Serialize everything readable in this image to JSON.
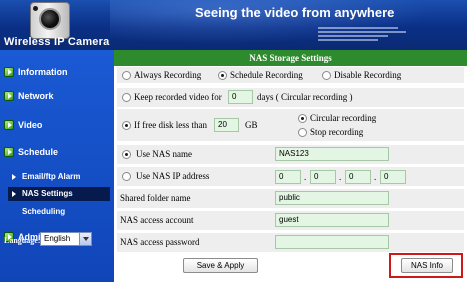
{
  "header": {
    "brand_title": "Wireless IP Camera",
    "tagline": "Seeing the video from anywhere"
  },
  "sidebar": {
    "items": [
      {
        "label": "Information"
      },
      {
        "label": "Network"
      },
      {
        "label": "Video"
      },
      {
        "label": "Schedule"
      },
      {
        "label": "Admin"
      }
    ],
    "schedule_sub": [
      {
        "label": "Email/ftp Alarm"
      },
      {
        "label": "NAS Settings",
        "active": true
      },
      {
        "label": "Scheduling"
      }
    ],
    "language_label": "Language:",
    "language_value": "English"
  },
  "panel": {
    "title": "NAS Storage Settings",
    "recording_modes": {
      "always": "Always Recording",
      "schedule": "Schedule Recording",
      "disable": "Disable Recording",
      "selected": "schedule"
    },
    "keep_video": {
      "prefix": "Keep recorded video for",
      "days_value": "0",
      "suffix": "days ( Circular recording )"
    },
    "free_disk": {
      "prefix": "If free disk less than",
      "gb_value": "20",
      "unit": "GB",
      "option_circular": "Circular recording",
      "option_stop": "Stop recording",
      "selected": "circular"
    },
    "use_nas_name": {
      "label": "Use NAS name",
      "value": "NAS123",
      "selected": true
    },
    "use_nas_ip": {
      "label": "Use NAS IP address",
      "octets": [
        "0",
        "0",
        "0",
        "0"
      ],
      "separator": "."
    },
    "shared_folder": {
      "label": "Shared folder name",
      "value": "public"
    },
    "access_account": {
      "label": "NAS access account",
      "value": "guest"
    },
    "access_password": {
      "label": "NAS access password",
      "value": ""
    },
    "save_button": "Save & Apply",
    "nas_info_button": "NAS Info"
  },
  "colors": {
    "header_blue": "#0a2f86",
    "sidebar_blue": "#1a5ad4",
    "panel_green": "#2d8a2d",
    "highlight_red": "#cc1a1a"
  }
}
